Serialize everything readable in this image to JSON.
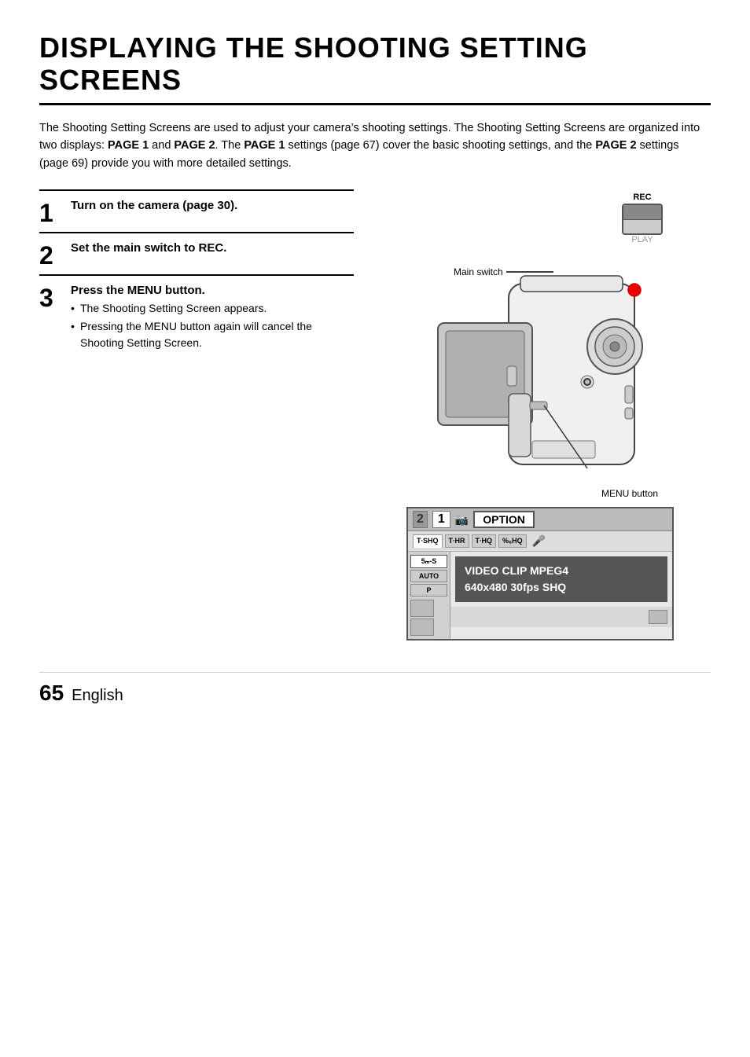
{
  "page": {
    "title": "DISPLAYING THE SHOOTING SETTING SCREENS",
    "intro": {
      "text1": "The Shooting Setting Screens are used to adjust your camera’s shooting settings. The Shooting Setting Screens are organized into two displays: ",
      "bold1": "PAGE 1",
      "text2": " and ",
      "bold2": "PAGE 2",
      "text3": ". The ",
      "bold3": "PAGE 1",
      "text4": " settings (page 67) cover the basic shooting settings, and the ",
      "bold4": "PAGE 2",
      "text5": " settings (page 69) provide you with more detailed settings."
    },
    "steps": [
      {
        "number": "1",
        "title": "Turn on the camera (page 30).",
        "bullets": []
      },
      {
        "number": "2",
        "title": "Set the main switch to REC.",
        "bullets": []
      },
      {
        "number": "3",
        "title": "Press the MENU button.",
        "bullets": [
          "The Shooting Setting Screen appears.",
          "Pressing the MENU button again will cancel the Shooting Setting Screen."
        ]
      }
    ],
    "diagram": {
      "rec_label": "REC",
      "play_label": "PLAY",
      "main_switch_label": "Main switch",
      "menu_button_label": "MENU button"
    },
    "screen": {
      "page_num": "1",
      "page2_num": "2",
      "option_label": "OPTION",
      "quality_tabs": [
        "T∙SHQ",
        "T∙HR",
        "T∙HQ",
        "%₆HQ"
      ],
      "left_items": [
        "5ₘ-S",
        "AUTO",
        "P"
      ],
      "video_info_line1": "VIDEO CLIP MPEG4",
      "video_info_line2": "640x480 30fps SHQ"
    },
    "footer": {
      "number": "65",
      "language": "English"
    }
  }
}
